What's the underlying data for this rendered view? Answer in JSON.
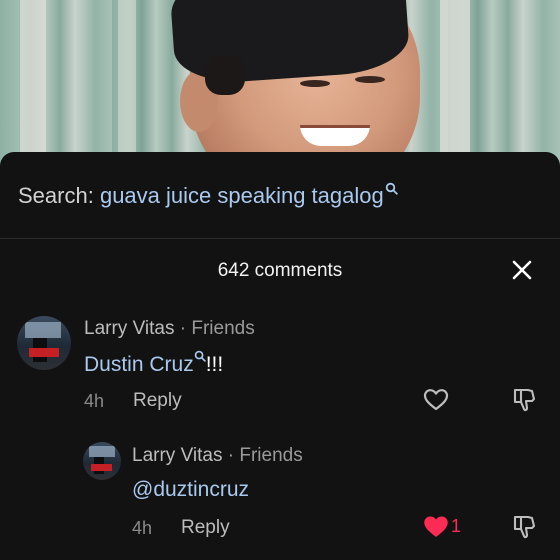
{
  "search": {
    "prefix": "Search:",
    "query": "guava juice speaking tagalog",
    "icon": "search-icon"
  },
  "comments_header": {
    "count_label": "642 comments",
    "close_icon": "close-icon"
  },
  "comments": [
    {
      "author": "Larry Vitas",
      "relation": "Friends",
      "mention": "Dustin Cruz",
      "tail": "!!!",
      "time": "4h",
      "reply_label": "Reply",
      "liked": false
    }
  ],
  "replies": [
    {
      "author": "Larry Vitas",
      "relation": "Friends",
      "text": "@duztincruz",
      "time": "4h",
      "reply_label": "Reply",
      "liked": true,
      "like_count": "1"
    }
  ],
  "colors": {
    "mention": "#a9c9ee",
    "like_active": "#fe2c55",
    "sheet_bg": "#121212"
  }
}
